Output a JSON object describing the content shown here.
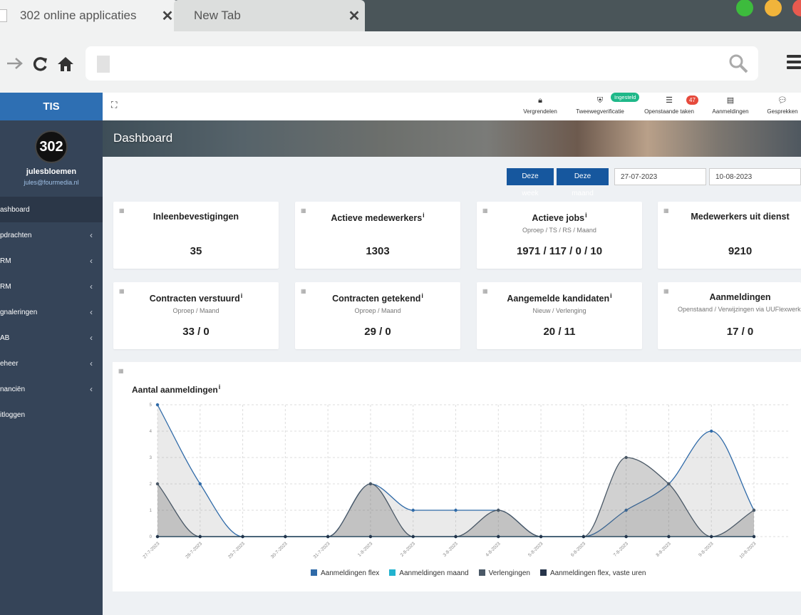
{
  "browser": {
    "tabs": [
      {
        "label": "302 online applicaties",
        "active": true
      },
      {
        "label": "New Tab",
        "active": false
      }
    ],
    "close_glyph": "✕",
    "window_buttons": [
      {
        "name": "maximize",
        "color": "#3dbb3d"
      },
      {
        "name": "minimize",
        "color": "#f1b43b"
      },
      {
        "name": "close",
        "color": "#e85a4f"
      }
    ],
    "nav_icons": [
      "forward-icon",
      "reload-icon",
      "home-icon"
    ],
    "url_value": ""
  },
  "sidebar": {
    "brand": "TIS",
    "logo_text": "302",
    "user_name": "julesbloemen",
    "user_email": "jules@fourmedia.nl",
    "items": [
      {
        "label": "ashboard",
        "active": true,
        "has_children": false
      },
      {
        "label": "pdrachten",
        "active": false,
        "has_children": true
      },
      {
        "label": "RM",
        "active": false,
        "has_children": true
      },
      {
        "label": "RM",
        "active": false,
        "has_children": true
      },
      {
        "label": "gnaleringen",
        "active": false,
        "has_children": true
      },
      {
        "label": "AB",
        "active": false,
        "has_children": true
      },
      {
        "label": "eheer",
        "active": false,
        "has_children": true
      },
      {
        "label": "nanciën",
        "active": false,
        "has_children": true
      },
      {
        "label": "itloggen",
        "active": false,
        "has_children": false
      }
    ]
  },
  "topbar": {
    "items": [
      {
        "label": "Vergrendelen",
        "icon": "lock-icon"
      },
      {
        "label": "Tweewegverificatie",
        "icon": "shield-icon",
        "badge": "Ingesteld"
      },
      {
        "label": "Openstaande taken",
        "icon": "list-icon",
        "badge": "47"
      },
      {
        "label": "Aanmeldingen",
        "icon": "file-icon"
      },
      {
        "label": "Gesprekken",
        "icon": "chat-icon"
      }
    ]
  },
  "hero": {
    "title": "Dashboard"
  },
  "filters": {
    "week_label": "Deze week",
    "month_label": "Deze maand",
    "date_from": "27-07-2023",
    "date_to": "10-08-2023"
  },
  "cards": [
    {
      "title": "Inleenbevestigingen",
      "info": false,
      "sub": "",
      "value": "35"
    },
    {
      "title": "Actieve medewerkers",
      "info": true,
      "sub": "",
      "value": "1303"
    },
    {
      "title": "Actieve jobs",
      "info": true,
      "sub": "Oproep / TS / RS / Maand",
      "value": "1971 / 117 / 0 / 10"
    },
    {
      "title": "Medewerkers uit dienst",
      "info": false,
      "sub": "",
      "value": "9210"
    },
    {
      "title": "Contracten verstuurd",
      "info": true,
      "sub": "Oproep / Maand",
      "value": "33 / 0"
    },
    {
      "title": "Contracten getekend",
      "info": true,
      "sub": "Oproep / Maand",
      "value": "29 / 0"
    },
    {
      "title": "Aangemelde kandidaten",
      "info": true,
      "sub": "Nieuw / Verlenging",
      "value": "20 / 11"
    },
    {
      "title": "Aanmeldingen",
      "info": false,
      "sub": "Openstaand / Verwijzingen via UUFlexwerk",
      "value": "17 / 0"
    }
  ],
  "chart_data": {
    "type": "area",
    "title": "Aantal aanmeldingen",
    "categories": [
      "27-7-2023",
      "28-7-2023",
      "29-7-2023",
      "30-7-2023",
      "31-7-2023",
      "1-8-2023",
      "2-8-2023",
      "3-8-2023",
      "4-8-2023",
      "5-8-2023",
      "6-8-2023",
      "7-8-2023",
      "8-8-2023",
      "9-8-2023",
      "10-8-2023"
    ],
    "ylim": [
      0,
      5
    ],
    "yticks": [
      0,
      1,
      2,
      3,
      4,
      5
    ],
    "grid": true,
    "legend": "bottom",
    "series": [
      {
        "name": "Aanmeldingen flex",
        "color": "#2f6aa8",
        "values": [
          5,
          2,
          0,
          0,
          0,
          2,
          1,
          1,
          1,
          0,
          0,
          1,
          2,
          4,
          1
        ]
      },
      {
        "name": "Aanmeldingen maand",
        "color": "#22b3cf",
        "values": [
          0,
          0,
          0,
          0,
          0,
          0,
          0,
          0,
          0,
          0,
          0,
          0,
          0,
          0,
          0
        ]
      },
      {
        "name": "Verlengingen",
        "color": "#4a5866",
        "values": [
          2,
          0,
          0,
          0,
          0,
          2,
          0,
          0,
          1,
          0,
          0,
          3,
          2,
          0,
          1
        ]
      },
      {
        "name": "Aanmeldingen flex, vaste uren",
        "color": "#26344a",
        "values": [
          0,
          0,
          0,
          0,
          0,
          0,
          0,
          0,
          0,
          0,
          0,
          0,
          0,
          0,
          0
        ]
      }
    ]
  }
}
